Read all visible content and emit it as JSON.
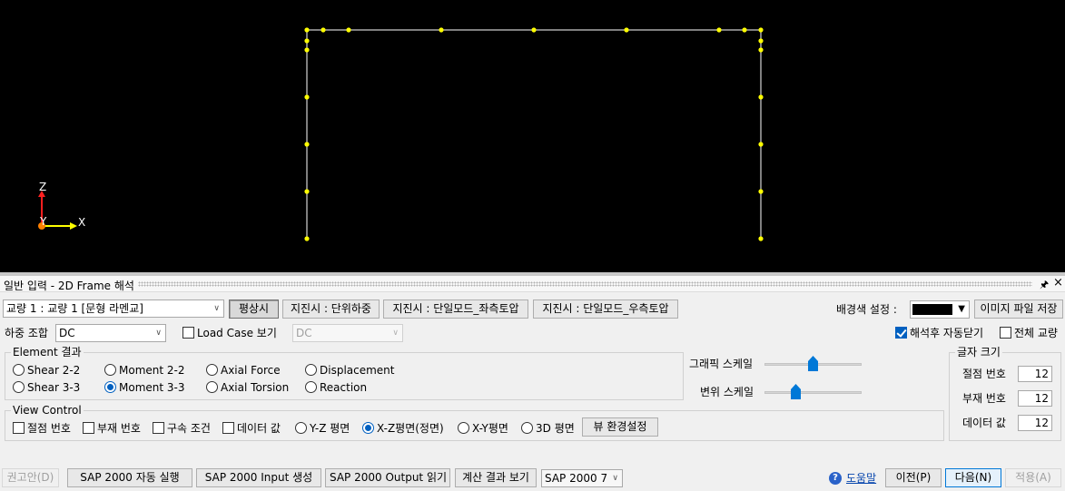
{
  "viewport": {
    "background": "#000000",
    "frame_color": "#ffffff",
    "node_color": "#ffff00",
    "axes": {
      "z_label": "Z",
      "y_label": "Y",
      "x_label": "X",
      "axis_color": "#ffff00",
      "origin_color": "#ff8000",
      "z_color": "#ff2020"
    }
  },
  "panel": {
    "title": "일반 입력 - 2D Frame 해석",
    "pin_icon": "pin-icon",
    "close_icon": "close-icon"
  },
  "top_row": {
    "bridge_select": "교량 1 : 교량 1 [문형 라멘교]",
    "tabs": [
      {
        "label": "평상시",
        "active": true
      },
      {
        "label": "지진시 : 단위하중",
        "active": false
      },
      {
        "label": "지진시 : 단일모드_좌측토압",
        "active": false
      },
      {
        "label": "지진시 : 단일모드_우측토압",
        "active": false
      }
    ],
    "bg_color_label": "배경색 설정 :",
    "bg_color_value": "#000000",
    "save_image_label": "이미지 파일 저장"
  },
  "row2": {
    "load_combo_label": "하중 조합",
    "load_combo_value": "DC",
    "load_case_view_label": "Load Case 보기",
    "load_case_view_checked": false,
    "load_case_value": "DC",
    "auto_close_label": "해석후 자동닫기",
    "auto_close_checked": true,
    "all_bridge_label": "전체 교량",
    "all_bridge_checked": false
  },
  "element_result": {
    "title": "Element 결과",
    "options": [
      {
        "label": "Shear 2-2",
        "selected": false
      },
      {
        "label": "Moment 2-2",
        "selected": false
      },
      {
        "label": "Axial Force",
        "selected": false
      },
      {
        "label": "Displacement",
        "selected": false
      },
      {
        "label": "Shear 3-3",
        "selected": false
      },
      {
        "label": "Moment 3-3",
        "selected": true
      },
      {
        "label": "Axial Torsion",
        "selected": false
      },
      {
        "label": "Reaction",
        "selected": false
      }
    ]
  },
  "scales": {
    "graphic_label": "그래픽 스케일",
    "graphic_level": 0.5,
    "disp_label": "변위 스케일",
    "disp_level": 0.3
  },
  "font_size": {
    "title": "글자 크기",
    "rows": [
      {
        "label": "절점 번호",
        "value": "12"
      },
      {
        "label": "부재 번호",
        "value": "12"
      },
      {
        "label": "데이터 값",
        "value": "12"
      }
    ]
  },
  "view_control": {
    "title": "View Control",
    "checks": [
      {
        "label": "절점 번호",
        "checked": false
      },
      {
        "label": "부재 번호",
        "checked": false
      },
      {
        "label": "구속 조건",
        "checked": false
      },
      {
        "label": "데이터 값",
        "checked": false
      }
    ],
    "planes": [
      {
        "label": "Y-Z 평면",
        "selected": false
      },
      {
        "label": "X-Z평면(정면)",
        "selected": true
      },
      {
        "label": "X-Y평면",
        "selected": false
      },
      {
        "label": "3D 평면",
        "selected": false
      }
    ],
    "view_settings_label": "뷰 환경설정"
  },
  "bottom": {
    "recommend_label": "권고안(D)",
    "sap_run_label": "SAP 2000 자동 실행",
    "sap_input_label": "SAP 2000 Input 생성",
    "sap_output_label": "SAP 2000 Output 읽기",
    "calc_view_label": "계산 결과 보기",
    "sap_version": "SAP 2000 7",
    "help_label": "도움말",
    "prev_label": "이전(P)",
    "next_label": "다음(N)",
    "apply_label": "적용(A)"
  }
}
